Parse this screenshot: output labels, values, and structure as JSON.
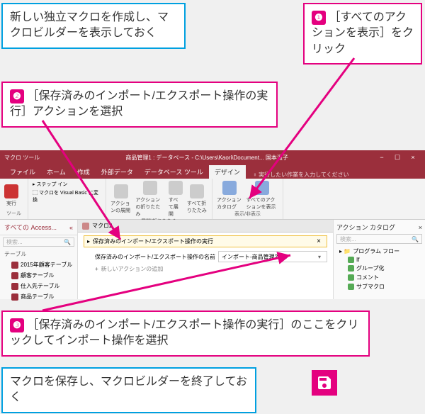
{
  "callouts": {
    "a": "新しい独立マクロを作成し、マクロビルダーを表示しておく",
    "b_num": "❶",
    "b": "［すべてのアクションを表示］をクリック",
    "c_num": "❷",
    "c": "［保存済みのインポート/エクスポート操作の実行］アクションを選択",
    "d_num": "❸",
    "d": "［保存済みのインポート/エクスポート操作の実行］のここをクリックしてインポート操作を選択",
    "e": "マクロを保存し、マクロビルダーを終了しておく"
  },
  "title": {
    "tooltab": "マクロ ツール",
    "full": "商品管理1 : データベース - C:\\Users\\Kaori\\Document...   国本温子"
  },
  "wbtns": {
    "min": "−",
    "max": "☐",
    "close": "×"
  },
  "tabs": [
    "ファイル",
    "ホーム",
    "作成",
    "外部データ",
    "データベース ツール",
    "デザイン"
  ],
  "tell_placeholder": "実行したい作業を入力してください",
  "ribbon": {
    "exec": {
      "label": "実行"
    },
    "tools": {
      "step": "ステップ イン",
      "vb": "マクロを Visual Basic に変換",
      "group": "ツール"
    },
    "layout": {
      "expand_action": "アクションの展開",
      "collapse_action": "アクションの折りたたみ",
      "expand_all": "すべて展開",
      "collapse_all": "すべて折りたたみ",
      "group": "展開/折りたたみ"
    },
    "show": {
      "catalog": "アクション カタログ",
      "showall": "すべてのアクションを表示",
      "group": "表示/非表示"
    }
  },
  "nav": {
    "header": "すべての Access...",
    "search_placeholder": "検索...",
    "section": "テーブル",
    "items": [
      "2015年顧客テーブル",
      "顧客テーブル",
      "仕入先テーブル",
      "商品テーブル"
    ]
  },
  "doc": {
    "tab": "マクロ2",
    "action_name": "保存済みのインポート/エクスポート操作の実行",
    "param_label": "保存済みのインポート/エクスポート操作の名前",
    "param_value": "インポート-商品管理2015",
    "add_action": "新しいアクションの追加",
    "close": "×"
  },
  "side": {
    "header": "アクション カタログ",
    "search_placeholder": "検索...",
    "flow": "プログラム フロー",
    "items": [
      "If",
      "グループ化",
      "コメント",
      "サブマクロ"
    ],
    "close": "×"
  }
}
